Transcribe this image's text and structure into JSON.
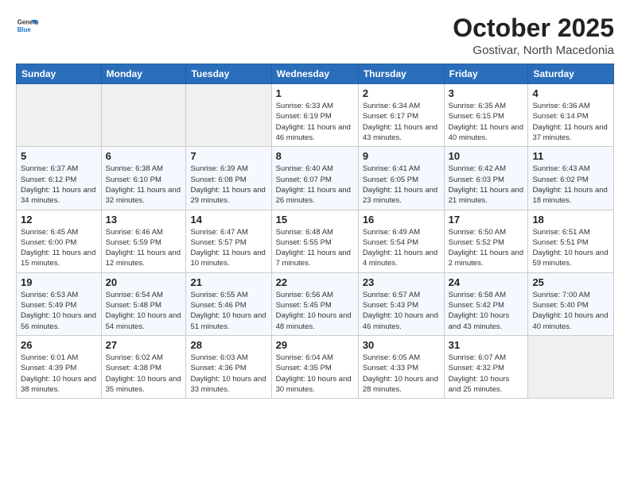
{
  "logo": {
    "line1": "General",
    "line2": "Blue"
  },
  "title": "October 2025",
  "subtitle": "Gostivar, North Macedonia",
  "weekdays": [
    "Sunday",
    "Monday",
    "Tuesday",
    "Wednesday",
    "Thursday",
    "Friday",
    "Saturday"
  ],
  "weeks": [
    [
      {
        "day": "",
        "info": ""
      },
      {
        "day": "",
        "info": ""
      },
      {
        "day": "",
        "info": ""
      },
      {
        "day": "1",
        "info": "Sunrise: 6:33 AM\nSunset: 6:19 PM\nDaylight: 11 hours\nand 46 minutes."
      },
      {
        "day": "2",
        "info": "Sunrise: 6:34 AM\nSunset: 6:17 PM\nDaylight: 11 hours\nand 43 minutes."
      },
      {
        "day": "3",
        "info": "Sunrise: 6:35 AM\nSunset: 6:15 PM\nDaylight: 11 hours\nand 40 minutes."
      },
      {
        "day": "4",
        "info": "Sunrise: 6:36 AM\nSunset: 6:14 PM\nDaylight: 11 hours\nand 37 minutes."
      }
    ],
    [
      {
        "day": "5",
        "info": "Sunrise: 6:37 AM\nSunset: 6:12 PM\nDaylight: 11 hours\nand 34 minutes."
      },
      {
        "day": "6",
        "info": "Sunrise: 6:38 AM\nSunset: 6:10 PM\nDaylight: 11 hours\nand 32 minutes."
      },
      {
        "day": "7",
        "info": "Sunrise: 6:39 AM\nSunset: 6:08 PM\nDaylight: 11 hours\nand 29 minutes."
      },
      {
        "day": "8",
        "info": "Sunrise: 6:40 AM\nSunset: 6:07 PM\nDaylight: 11 hours\nand 26 minutes."
      },
      {
        "day": "9",
        "info": "Sunrise: 6:41 AM\nSunset: 6:05 PM\nDaylight: 11 hours\nand 23 minutes."
      },
      {
        "day": "10",
        "info": "Sunrise: 6:42 AM\nSunset: 6:03 PM\nDaylight: 11 hours\nand 21 minutes."
      },
      {
        "day": "11",
        "info": "Sunrise: 6:43 AM\nSunset: 6:02 PM\nDaylight: 11 hours\nand 18 minutes."
      }
    ],
    [
      {
        "day": "12",
        "info": "Sunrise: 6:45 AM\nSunset: 6:00 PM\nDaylight: 11 hours\nand 15 minutes."
      },
      {
        "day": "13",
        "info": "Sunrise: 6:46 AM\nSunset: 5:59 PM\nDaylight: 11 hours\nand 12 minutes."
      },
      {
        "day": "14",
        "info": "Sunrise: 6:47 AM\nSunset: 5:57 PM\nDaylight: 11 hours\nand 10 minutes."
      },
      {
        "day": "15",
        "info": "Sunrise: 6:48 AM\nSunset: 5:55 PM\nDaylight: 11 hours\nand 7 minutes."
      },
      {
        "day": "16",
        "info": "Sunrise: 6:49 AM\nSunset: 5:54 PM\nDaylight: 11 hours\nand 4 minutes."
      },
      {
        "day": "17",
        "info": "Sunrise: 6:50 AM\nSunset: 5:52 PM\nDaylight: 11 hours\nand 2 minutes."
      },
      {
        "day": "18",
        "info": "Sunrise: 6:51 AM\nSunset: 5:51 PM\nDaylight: 10 hours\nand 59 minutes."
      }
    ],
    [
      {
        "day": "19",
        "info": "Sunrise: 6:53 AM\nSunset: 5:49 PM\nDaylight: 10 hours\nand 56 minutes."
      },
      {
        "day": "20",
        "info": "Sunrise: 6:54 AM\nSunset: 5:48 PM\nDaylight: 10 hours\nand 54 minutes."
      },
      {
        "day": "21",
        "info": "Sunrise: 6:55 AM\nSunset: 5:46 PM\nDaylight: 10 hours\nand 51 minutes."
      },
      {
        "day": "22",
        "info": "Sunrise: 6:56 AM\nSunset: 5:45 PM\nDaylight: 10 hours\nand 48 minutes."
      },
      {
        "day": "23",
        "info": "Sunrise: 6:57 AM\nSunset: 5:43 PM\nDaylight: 10 hours\nand 46 minutes."
      },
      {
        "day": "24",
        "info": "Sunrise: 6:58 AM\nSunset: 5:42 PM\nDaylight: 10 hours\nand 43 minutes."
      },
      {
        "day": "25",
        "info": "Sunrise: 7:00 AM\nSunset: 5:40 PM\nDaylight: 10 hours\nand 40 minutes."
      }
    ],
    [
      {
        "day": "26",
        "info": "Sunrise: 6:01 AM\nSunset: 4:39 PM\nDaylight: 10 hours\nand 38 minutes."
      },
      {
        "day": "27",
        "info": "Sunrise: 6:02 AM\nSunset: 4:38 PM\nDaylight: 10 hours\nand 35 minutes."
      },
      {
        "day": "28",
        "info": "Sunrise: 6:03 AM\nSunset: 4:36 PM\nDaylight: 10 hours\nand 33 minutes."
      },
      {
        "day": "29",
        "info": "Sunrise: 6:04 AM\nSunset: 4:35 PM\nDaylight: 10 hours\nand 30 minutes."
      },
      {
        "day": "30",
        "info": "Sunrise: 6:05 AM\nSunset: 4:33 PM\nDaylight: 10 hours\nand 28 minutes."
      },
      {
        "day": "31",
        "info": "Sunrise: 6:07 AM\nSunset: 4:32 PM\nDaylight: 10 hours\nand 25 minutes."
      },
      {
        "day": "",
        "info": ""
      }
    ]
  ]
}
